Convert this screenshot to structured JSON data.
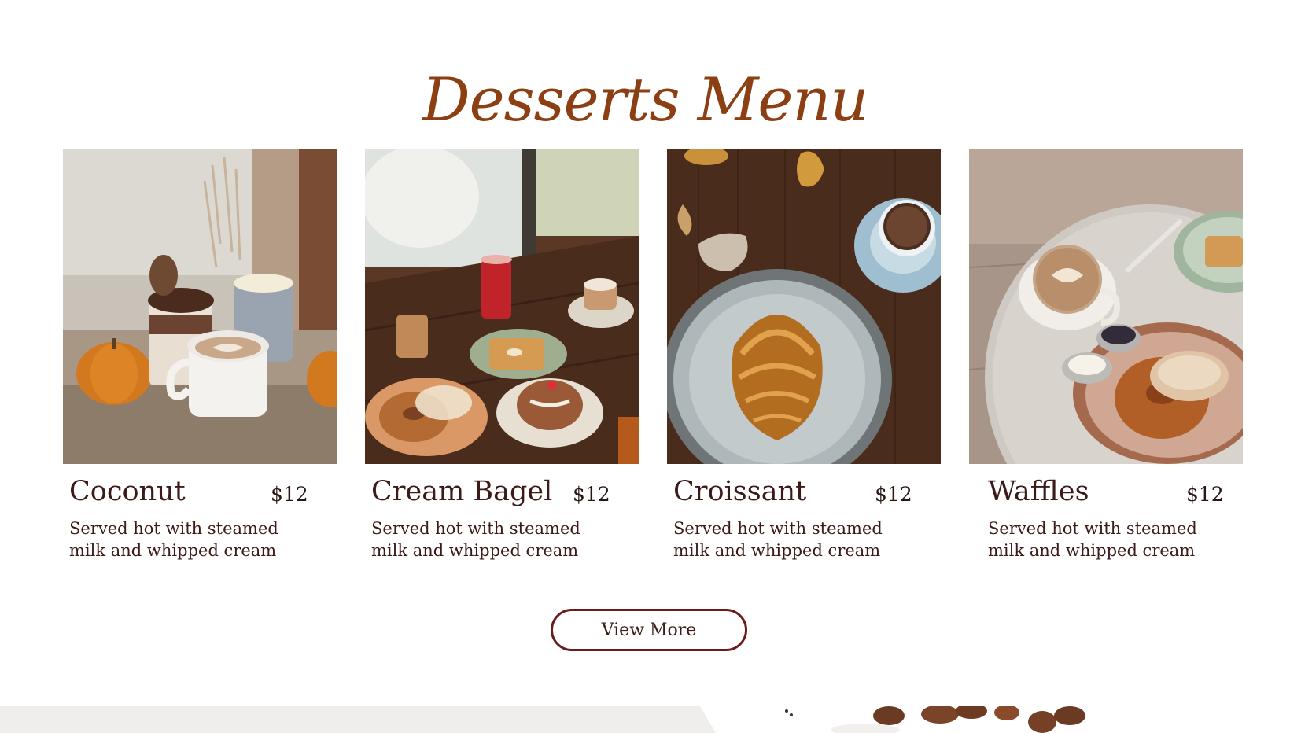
{
  "page": {
    "title": "Desserts Menu"
  },
  "menu_items": [
    {
      "name": "Coconut",
      "price": "$12",
      "description": "Served hot with steamed milk and whipped cream",
      "image": "coconut-dessert-photo"
    },
    {
      "name": "Cream Bagel",
      "price": "$12",
      "description": "Served hot with steamed milk and whipped cream",
      "image": "cream-bagel-photo"
    },
    {
      "name": "Croissant",
      "price": "$12",
      "description": "Served hot with steamed milk and whipped cream",
      "image": "croissant-photo"
    },
    {
      "name": "Waffles",
      "price": "$12",
      "description": "Served hot with steamed milk and whipped cream",
      "image": "waffles-photo"
    }
  ],
  "actions": {
    "view_more_label": "View More"
  },
  "colors": {
    "title": "#8b3f12",
    "text": "#3b1a17",
    "button_border": "#6a1c1c",
    "background": "#ffffff"
  }
}
